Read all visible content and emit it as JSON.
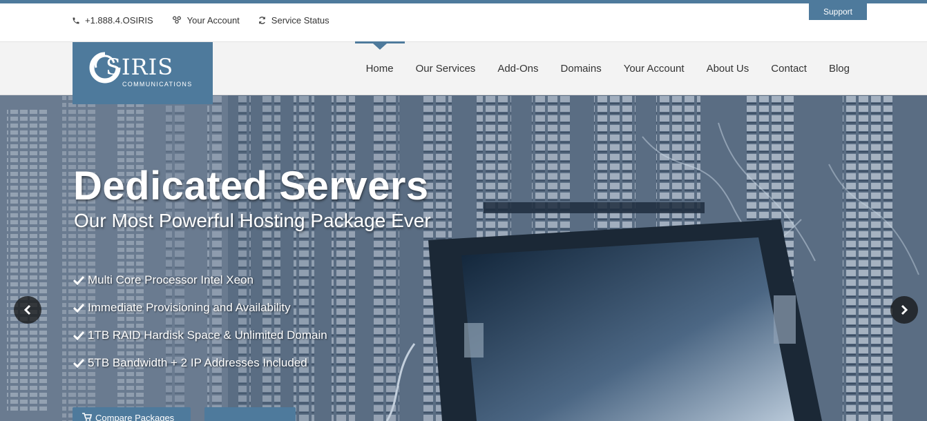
{
  "topbar": {
    "phone": "+1.888.4.OSIRIS",
    "account": "Your Account",
    "status": "Service Status",
    "support": "Support"
  },
  "logo": {
    "name": "SIRIS",
    "subtitle": "COMMUNICATIONS"
  },
  "nav": {
    "items": [
      "Home",
      "Our Services",
      "Add-Ons",
      "Domains",
      "Your Account",
      "About Us",
      "Contact",
      "Blog"
    ],
    "active": "Home"
  },
  "hero": {
    "title": "Dedicated Servers",
    "subtitle": "Our Most Powerful Hosting Package Ever",
    "features": [
      "Multi Core Processor Intel Xeon",
      "Immediate Provisioning and Availability",
      "1TB RAID Hardisk Space & Unlimited Domain",
      "5TB Bandwidth + 2 IP Addresses Included"
    ],
    "compare_button": "Compare Packages",
    "second_button": ""
  },
  "colors": {
    "accent": "#4e7a9c",
    "nav_bg": "#f3f3f3"
  }
}
